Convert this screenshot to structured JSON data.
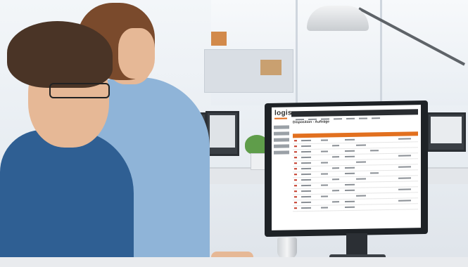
{
  "app": {
    "logo_text": "logis",
    "page_title": "Disposition - Aufträge"
  },
  "colors": {
    "accent": "#e2701f",
    "nav": "#2a2d31",
    "status_red": "#c43b2a"
  }
}
